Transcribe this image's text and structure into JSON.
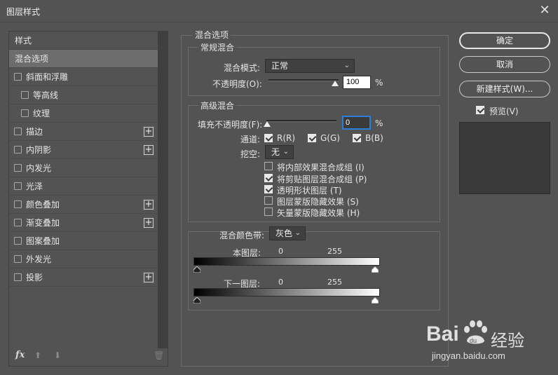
{
  "window": {
    "title": "图层样式",
    "close_glyph": "✕"
  },
  "left_panel": {
    "header": "样式",
    "selected": "混合选项",
    "items": [
      {
        "label": "斜面和浮雕",
        "indent": false,
        "plus": false
      },
      {
        "label": "等高线",
        "indent": true,
        "plus": false
      },
      {
        "label": "纹理",
        "indent": true,
        "plus": false
      },
      {
        "label": "描边",
        "indent": false,
        "plus": true
      },
      {
        "label": "内阴影",
        "indent": false,
        "plus": true
      },
      {
        "label": "内发光",
        "indent": false,
        "plus": false
      },
      {
        "label": "光泽",
        "indent": false,
        "plus": false
      },
      {
        "label": "颜色叠加",
        "indent": false,
        "plus": true
      },
      {
        "label": "渐变叠加",
        "indent": false,
        "plus": true
      },
      {
        "label": "图案叠加",
        "indent": false,
        "plus": false
      },
      {
        "label": "外发光",
        "indent": false,
        "plus": false
      },
      {
        "label": "投影",
        "indent": false,
        "plus": true
      }
    ],
    "plus_glyph": "+",
    "footer": {
      "fx": "fx",
      "up_glyph": "⬆",
      "down_glyph": "⬇",
      "trash_glyph": "🗑"
    }
  },
  "blending": {
    "section_title": "混合选项",
    "general": {
      "title": "常规混合",
      "blend_mode_label": "混合模式:",
      "blend_mode_value": "正常",
      "opacity_label": "不透明度(O):",
      "opacity_value": "100",
      "percent": "%"
    },
    "advanced": {
      "title": "高级混合",
      "fill_opacity_label": "填充不透明度(F):",
      "fill_opacity_value": "0",
      "percent": "%",
      "channels_label": "通道:",
      "channels": [
        {
          "label": "R(R)",
          "checked": true
        },
        {
          "label": "G(G)",
          "checked": true
        },
        {
          "label": "B(B)",
          "checked": true
        }
      ],
      "knockout_label": "挖空:",
      "knockout_value": "无",
      "options": [
        {
          "label": "将内部效果混合成组 (I)",
          "checked": false
        },
        {
          "label": "将剪贴图层混合成组 (P)",
          "checked": true
        },
        {
          "label": "透明形状图层 (T)",
          "checked": true
        },
        {
          "label": "图层蒙版隐藏效果 (S)",
          "checked": false
        },
        {
          "label": "矢量蒙版隐藏效果 (H)",
          "checked": false
        }
      ]
    },
    "blend_if": {
      "label": "混合颜色带:",
      "value": "灰色",
      "this_layer_label": "本图层:",
      "this_layer_min": "0",
      "this_layer_max": "255",
      "underlying_label": "下一图层:",
      "underlying_min": "0",
      "underlying_max": "255"
    }
  },
  "buttons": {
    "ok": "确定",
    "cancel": "取消",
    "new_style": "新建样式(W)...",
    "preview_label": "预览(V)",
    "preview_checked": true
  },
  "watermark": {
    "brand": "Bai",
    "brand_du": "du",
    "cn": "经验",
    "url": "jingyan.baidu.com"
  },
  "icons": {
    "dropdown": "chevron-down-icon",
    "close": "close-icon",
    "paw": "paw-icon"
  }
}
